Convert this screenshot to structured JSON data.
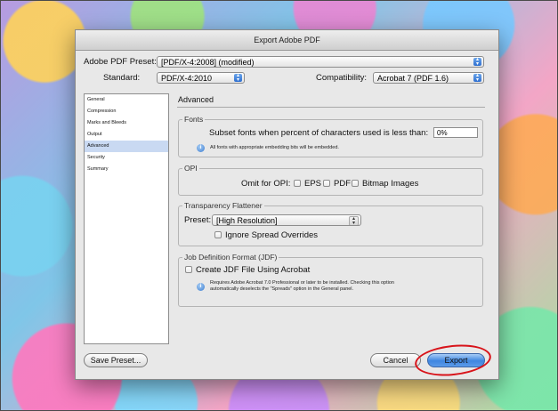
{
  "dialog": {
    "title": "Export Adobe PDF",
    "preset_label": "Adobe PDF Preset:",
    "preset_value": "[PDF/X-4:2008] (modified)",
    "standard_label": "Standard:",
    "standard_value": "PDF/X-4:2010",
    "compat_label": "Compatibility:",
    "compat_value": "Acrobat 7 (PDF 1.6)"
  },
  "sidebar": {
    "items": [
      {
        "label": "General"
      },
      {
        "label": "Compression"
      },
      {
        "label": "Marks and Bleeds"
      },
      {
        "label": "Output"
      },
      {
        "label": "Advanced"
      },
      {
        "label": "Security"
      },
      {
        "label": "Summary"
      }
    ],
    "selected": "Advanced"
  },
  "pane": {
    "title": "Advanced",
    "fonts": {
      "legend": "Fonts",
      "subset_label": "Subset fonts when percent of characters used is less than:",
      "subset_value": "0%",
      "note": "All fonts with appropriate embedding bits will be embedded."
    },
    "opi": {
      "legend": "OPI",
      "omit_label": "Omit for OPI:",
      "eps": "EPS",
      "pdf": "PDF",
      "bitmap": "Bitmap Images"
    },
    "flattener": {
      "legend": "Transparency Flattener",
      "preset_label": "Preset:",
      "preset_value": "[High Resolution]",
      "ignore_label": "Ignore Spread Overrides"
    },
    "jdf": {
      "legend": "Job Definition Format (JDF)",
      "create_label": "Create JDF File Using Acrobat",
      "note_line1": "Requires Adobe Acrobat 7.0 Professional or later to be installed. Checking this option",
      "note_line2": "automatically deselects the \"Spreads\" option in the General panel."
    }
  },
  "buttons": {
    "save_preset": "Save Preset...",
    "cancel": "Cancel",
    "export": "Export"
  },
  "colors": {
    "selection": "#c9d9f2",
    "default_button": "#3f86e0",
    "annotation": "#d8131a"
  }
}
